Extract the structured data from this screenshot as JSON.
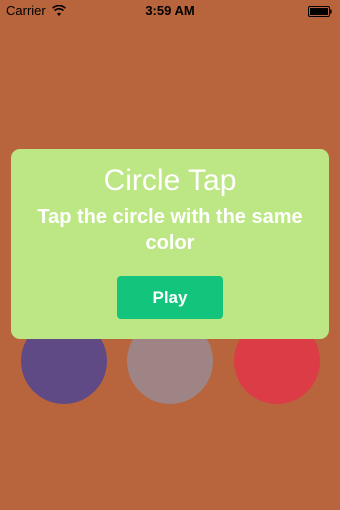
{
  "status_bar": {
    "carrier": "Carrier",
    "time": "3:59 AM",
    "wifi_icon": "wifi-icon",
    "battery_icon": "battery-icon"
  },
  "background_color": "#b8643c",
  "circles": [
    {
      "color": "#5f4a86"
    },
    {
      "color": "#9e8484"
    },
    {
      "color": "#dc3c46"
    }
  ],
  "dialog": {
    "title": "Circle Tap",
    "subtitle": "Tap the circle with the same color",
    "play_label": "Play",
    "background_color": "#bde684",
    "button_color": "#13c47c"
  }
}
